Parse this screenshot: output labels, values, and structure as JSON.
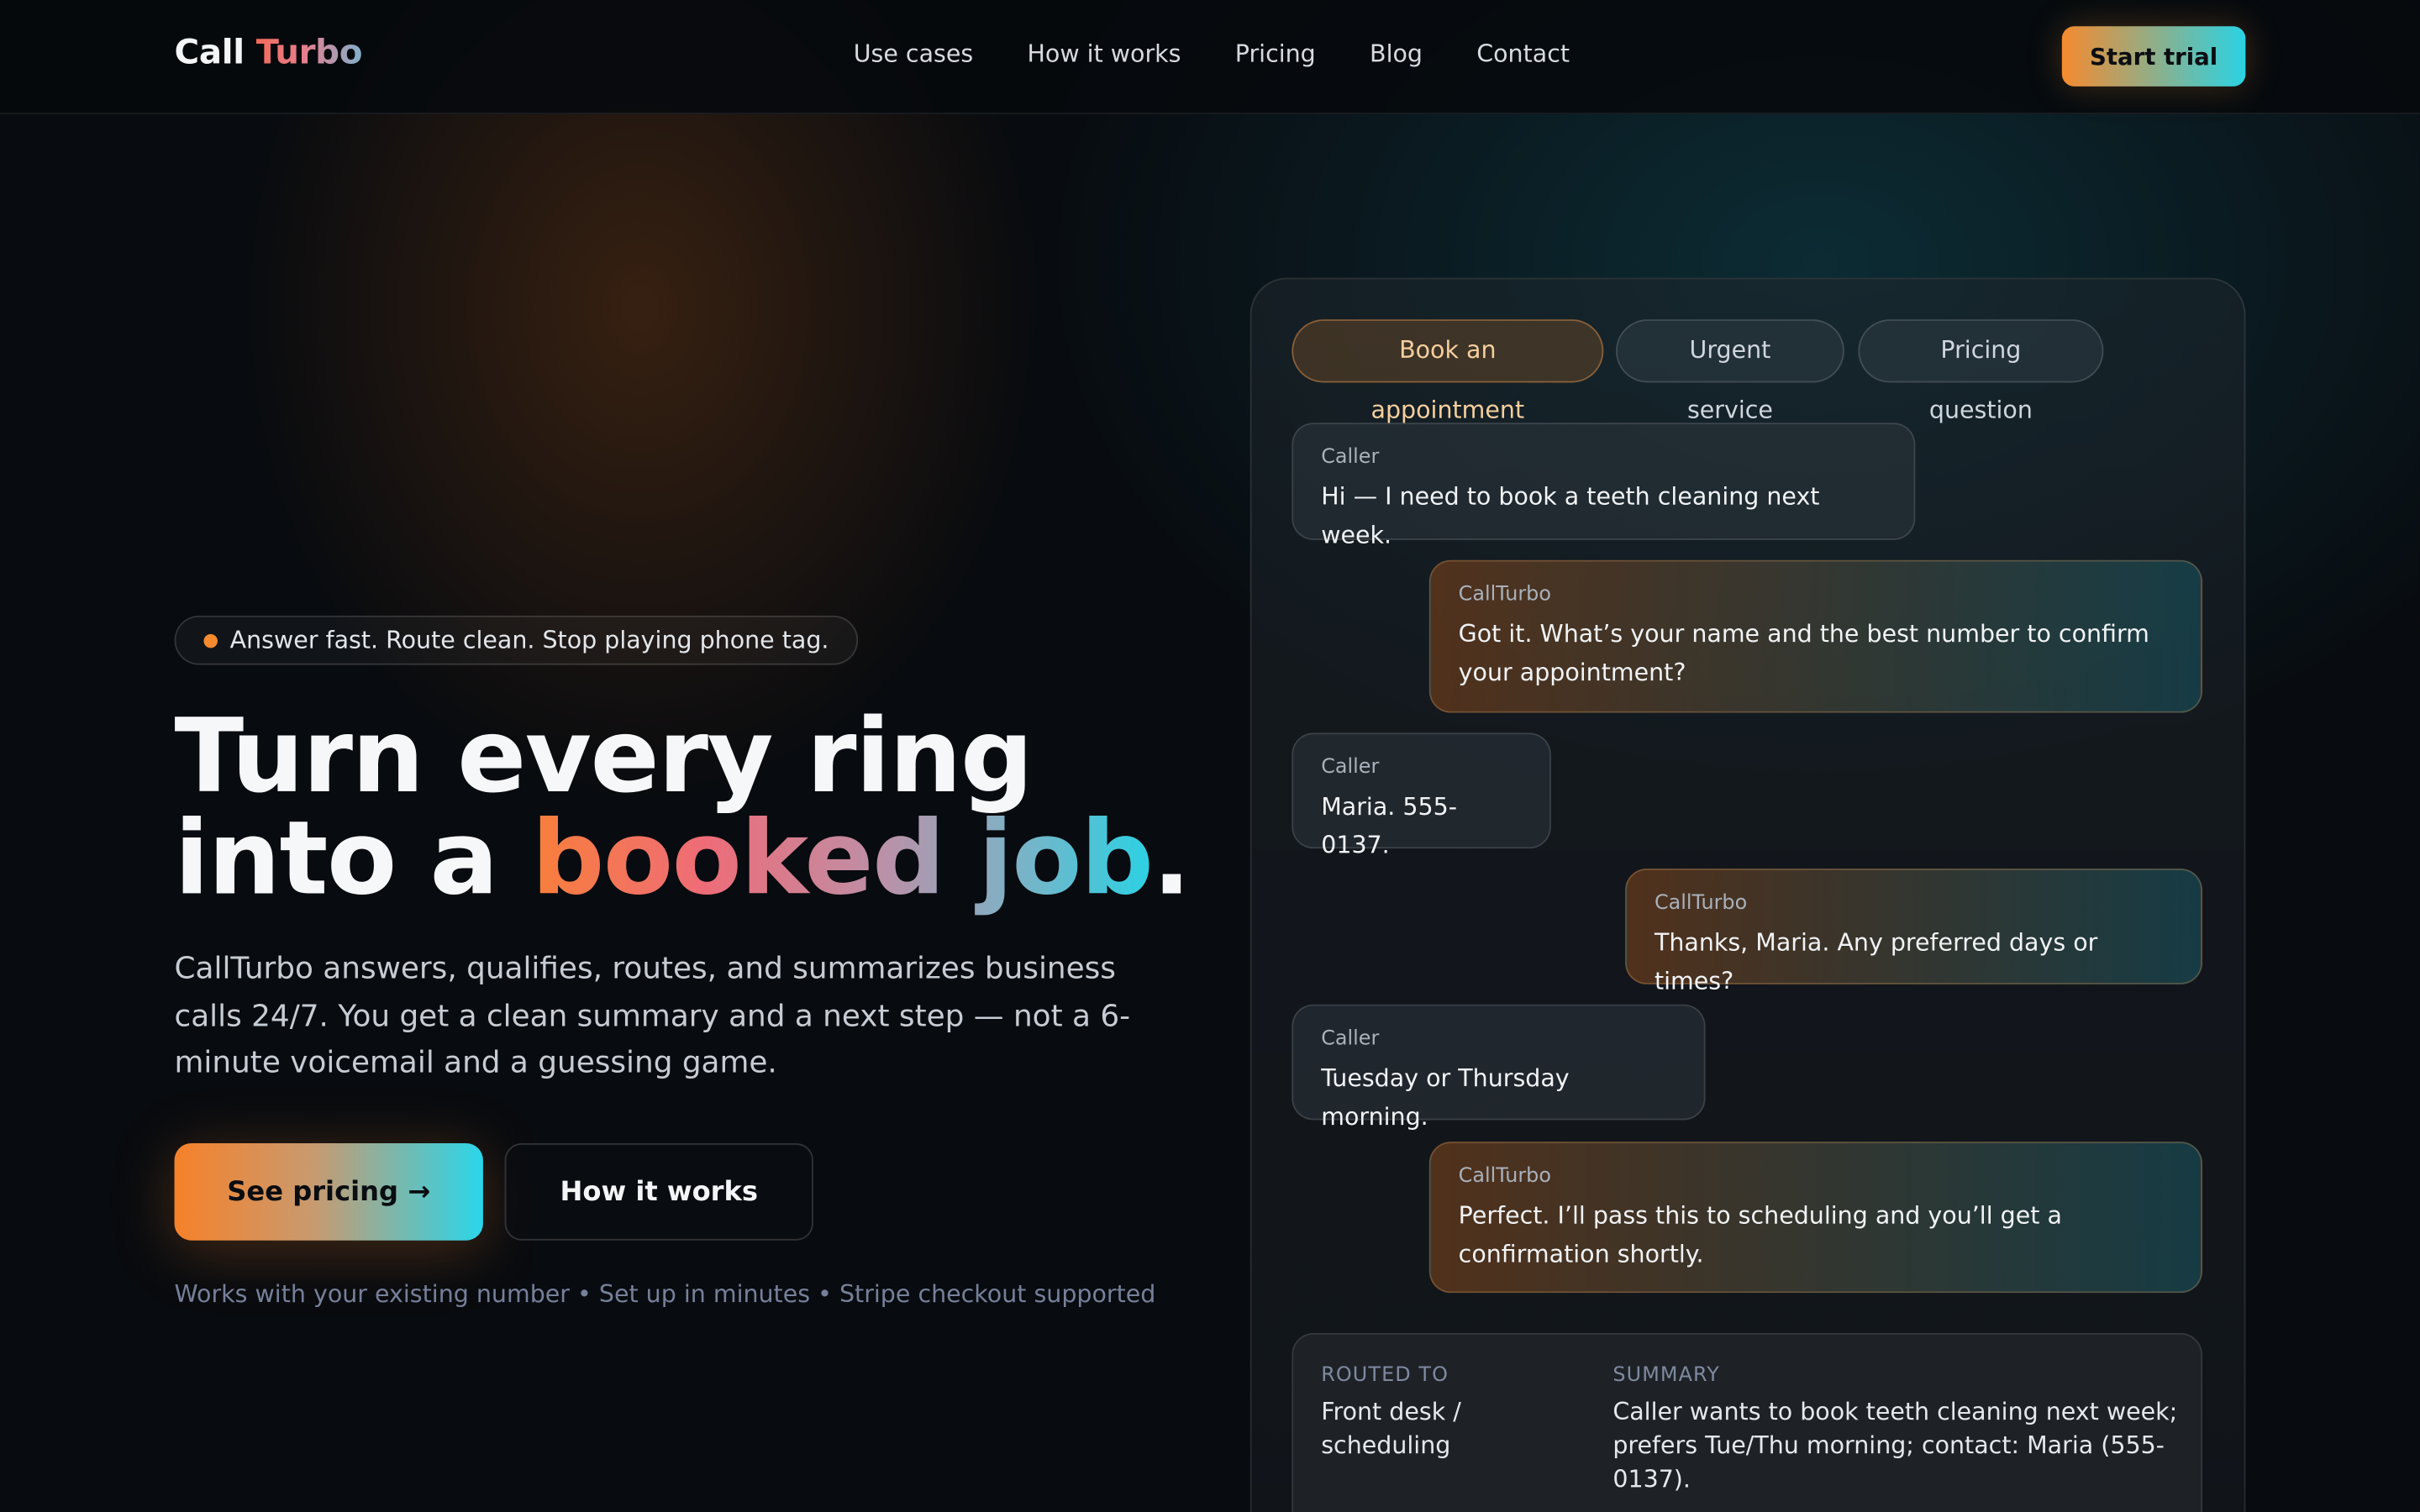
{
  "nav": {
    "logo_part1": "Call",
    "logo_part2": "Turbo",
    "links": [
      "Use cases",
      "How it works",
      "Pricing",
      "Blog",
      "Contact"
    ],
    "cta_label": "Start trial"
  },
  "hero": {
    "tagline": "Answer fast. Route clean. Stop playing phone tag.",
    "headline_line1": "Turn every ring",
    "headline_line2_prefix": "into a ",
    "headline_highlight": "booked job",
    "headline_period": ".",
    "subtitle": "CallTurbo answers, qualifies, routes, and summarizes business calls 24/7. You get a clean summary and a next step — not a 6-minute voicemail and a guessing game.",
    "primary_cta": "See pricing →",
    "secondary_cta": "How it works",
    "footnote": "Works with your existing number • Set up in minutes • Stripe checkout supported"
  },
  "demo": {
    "scenarios": [
      "Book an appointment",
      "Urgent service",
      "Pricing question"
    ],
    "active_scenario": "Book an appointment",
    "messages": [
      {
        "speaker": "Caller",
        "text": "Hi — I need to book a teeth cleaning next week."
      },
      {
        "speaker": "CallTurbo",
        "text": "Got it. What’s your name and the best number to confirm your appointment?"
      },
      {
        "speaker": "Caller",
        "text": "Maria. 555-0137."
      },
      {
        "speaker": "CallTurbo",
        "text": "Thanks, Maria. Any preferred days or times?"
      },
      {
        "speaker": "Caller",
        "text": "Tuesday or Thursday morning."
      },
      {
        "speaker": "CallTurbo",
        "text": "Perfect. I’ll pass this to scheduling and you’ll get a confirmation shortly."
      }
    ],
    "summary": {
      "routed_label": "ROUTED TO",
      "routed_value": "Front desk / scheduling",
      "summary_label": "SUMMARY",
      "summary_value": "Caller wants to book teeth cleaning next week; prefers Tue/Thu morning; contact: Maria (555-0137)."
    }
  },
  "colors": {
    "accent_orange": "#f58a2e",
    "accent_cyan": "#2ad3e4",
    "background": "#080b0f"
  }
}
